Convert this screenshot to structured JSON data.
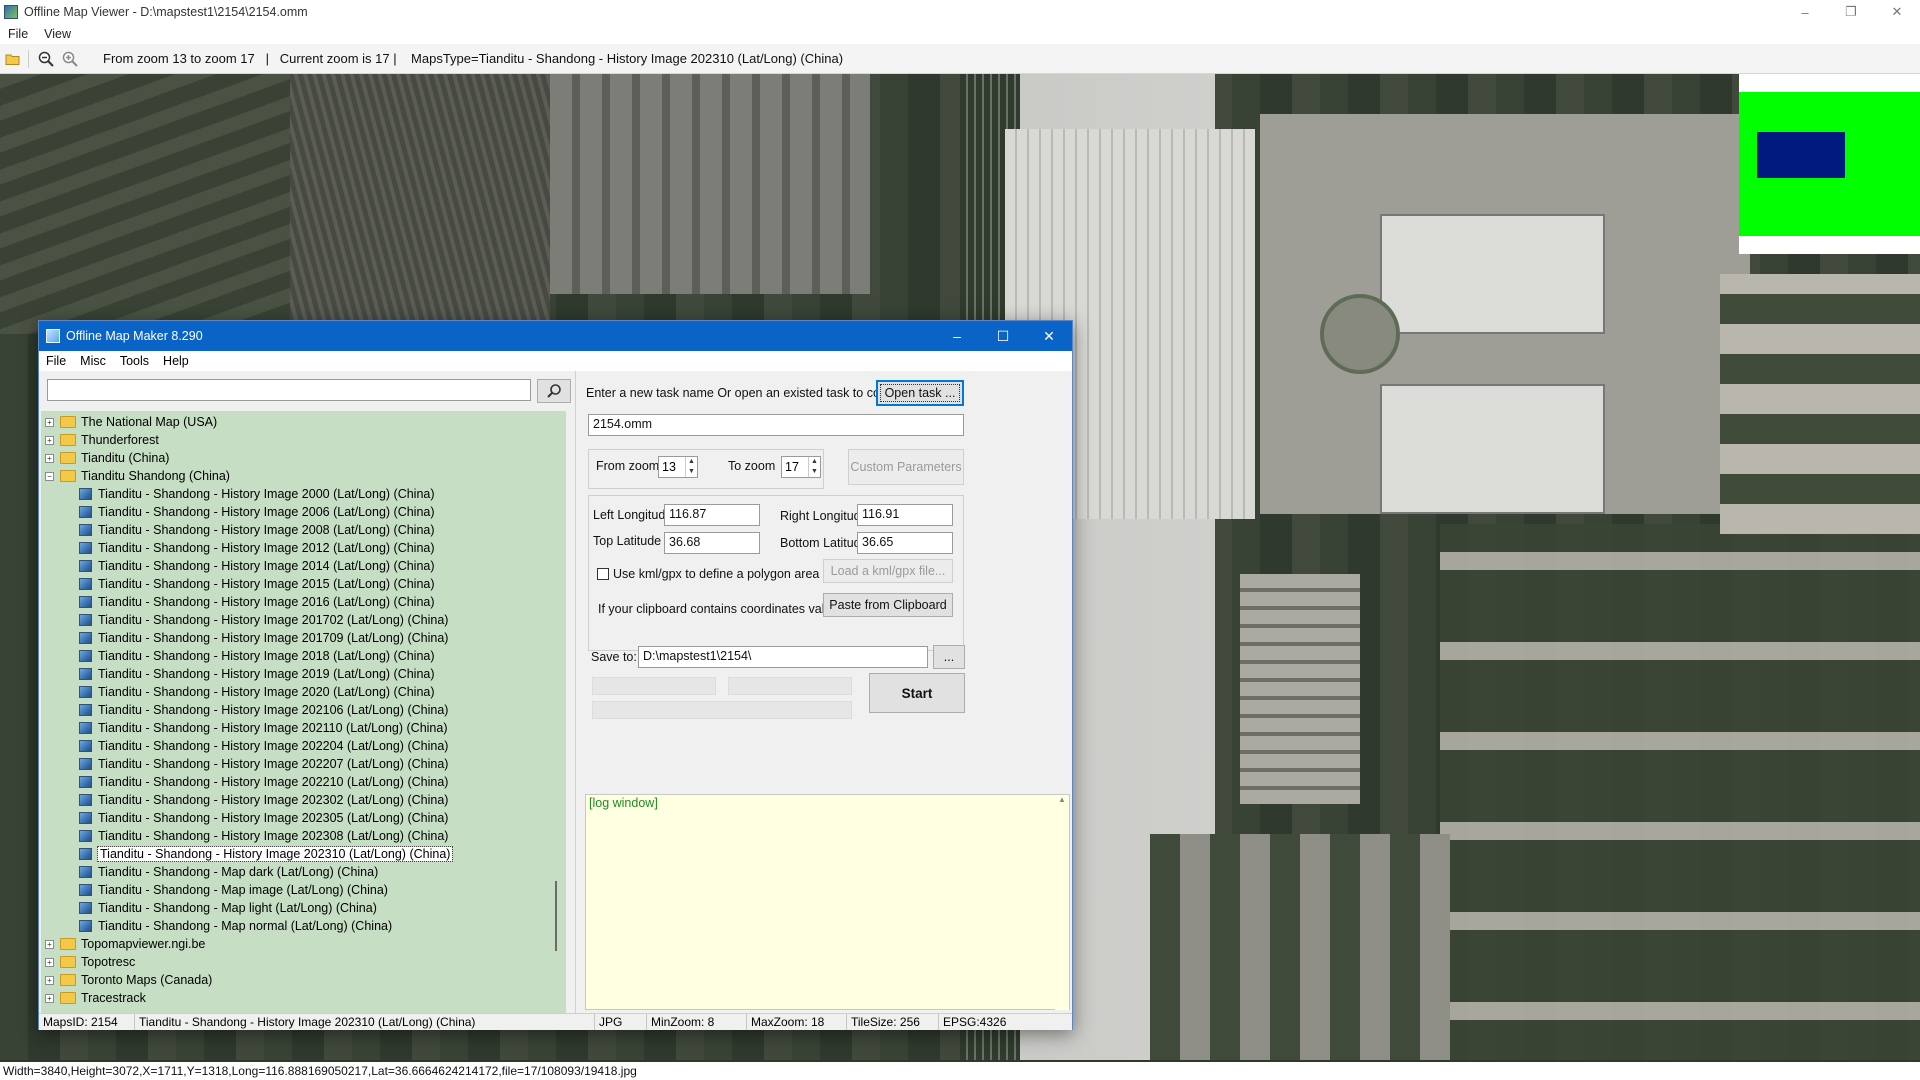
{
  "viewer": {
    "title": "Offline Map Viewer - D:\\mapstest1\\2154\\2154.omm",
    "menu": [
      "File",
      "View"
    ],
    "toolbar_info": "From zoom 13 to zoom 17   |   Current zoom is 17 |    MapsType=Tianditu - Shandong - History Image 202310 (Lat/Long) (China)",
    "status": "Width=3840,Height=3072,X=1711,Y=1318,Long=116.888169050217,Lat=36.6664624214172,file=17/108093/19418.jpg",
    "controls": [
      "–",
      "❐",
      "✕"
    ],
    "colors": {
      "minimap_bg": "#00ff00",
      "minimap_view": "#001a80"
    }
  },
  "dialog": {
    "title": "Offline Map Maker 8.290",
    "menu": [
      "File",
      "Misc",
      "Tools",
      "Help"
    ],
    "controls": [
      "–",
      "☐",
      "✕"
    ],
    "search": {
      "value": "",
      "icon": "search-icon"
    },
    "tree": [
      {
        "label": "The National Map (USA)",
        "type": "folder",
        "expander": "+"
      },
      {
        "label": "Thunderforest",
        "type": "folder",
        "expander": "+"
      },
      {
        "label": "Tianditu (China)",
        "type": "folder",
        "expander": "+"
      },
      {
        "label": "Tianditu Shandong (China)",
        "type": "folder",
        "expander": "−",
        "open": true
      },
      {
        "label": "Tianditu - Shandong - History Image 2000 (Lat/Long) (China)",
        "type": "map"
      },
      {
        "label": "Tianditu - Shandong - History Image 2006 (Lat/Long) (China)",
        "type": "map"
      },
      {
        "label": "Tianditu - Shandong - History Image 2008 (Lat/Long) (China)",
        "type": "map"
      },
      {
        "label": "Tianditu - Shandong - History Image 2012 (Lat/Long) (China)",
        "type": "map"
      },
      {
        "label": "Tianditu - Shandong - History Image 2014 (Lat/Long) (China)",
        "type": "map"
      },
      {
        "label": "Tianditu - Shandong - History Image 2015 (Lat/Long) (China)",
        "type": "map"
      },
      {
        "label": "Tianditu - Shandong - History Image 2016 (Lat/Long) (China)",
        "type": "map"
      },
      {
        "label": "Tianditu - Shandong - History Image 201702 (Lat/Long) (China)",
        "type": "map"
      },
      {
        "label": "Tianditu - Shandong - History Image 201709 (Lat/Long) (China)",
        "type": "map"
      },
      {
        "label": "Tianditu - Shandong - History Image 2018 (Lat/Long) (China)",
        "type": "map"
      },
      {
        "label": "Tianditu - Shandong - History Image 2019 (Lat/Long) (China)",
        "type": "map"
      },
      {
        "label": "Tianditu - Shandong - History Image 2020 (Lat/Long) (China)",
        "type": "map"
      },
      {
        "label": "Tianditu - Shandong - History Image 202106 (Lat/Long) (China)",
        "type": "map"
      },
      {
        "label": "Tianditu - Shandong - History Image 202110 (Lat/Long) (China)",
        "type": "map"
      },
      {
        "label": "Tianditu - Shandong - History Image 202204 (Lat/Long) (China)",
        "type": "map"
      },
      {
        "label": "Tianditu - Shandong - History Image 202207 (Lat/Long) (China)",
        "type": "map"
      },
      {
        "label": "Tianditu - Shandong - History Image 202210 (Lat/Long) (China)",
        "type": "map"
      },
      {
        "label": "Tianditu - Shandong - History Image 202302 (Lat/Long) (China)",
        "type": "map"
      },
      {
        "label": "Tianditu - Shandong - History Image 202305 (Lat/Long) (China)",
        "type": "map"
      },
      {
        "label": "Tianditu - Shandong - History Image 202308 (Lat/Long) (China)",
        "type": "map"
      },
      {
        "label": "Tianditu - Shandong - History Image 202310 (Lat/Long) (China)",
        "type": "map",
        "selected": true
      },
      {
        "label": "Tianditu - Shandong - Map dark (Lat/Long) (China)",
        "type": "map"
      },
      {
        "label": "Tianditu - Shandong - Map image (Lat/Long) (China)",
        "type": "map"
      },
      {
        "label": "Tianditu - Shandong - Map light (Lat/Long) (China)",
        "type": "map"
      },
      {
        "label": "Tianditu - Shandong - Map normal (Lat/Long) (China)",
        "type": "map"
      },
      {
        "label": "Topomapviewer.ngi.be",
        "type": "folder",
        "expander": "+"
      },
      {
        "label": "Topotresc",
        "type": "folder",
        "expander": "+"
      },
      {
        "label": "Toronto Maps (Canada)",
        "type": "folder",
        "expander": "+"
      },
      {
        "label": "Tracestrack",
        "type": "folder",
        "expander": "+"
      }
    ],
    "task_prompt": "Enter a new task name Or open an existed task to continue:",
    "open_task_label": "Open task ...",
    "task_name": "2154.omm",
    "from_zoom_label": "From zoom",
    "from_zoom": "13",
    "to_zoom_label": "To zoom",
    "to_zoom": "17",
    "custom_params_label": "Custom Parameters",
    "left_lon_label": "Left Longitude",
    "left_lon": "116.87",
    "right_lon_label": "Right Longitude",
    "right_lon": "116.91",
    "top_lat_label": "Top Latitude",
    "top_lat": "36.68",
    "bottom_lat_label": "Bottom Latitude",
    "bottom_lat": "36.65",
    "kml_label": "Use kml/gpx to define a polygon area",
    "load_kml_label": "Load a kml/gpx file...",
    "clipboard_prompt": "If your clipboard contains coordinates values:",
    "paste_label": "Paste from Clipboard",
    "save_to_label": "Save to:",
    "save_to": "D:\\mapstest1\\2154\\",
    "browse_label": "...",
    "start_label": "Start",
    "log_text": "[log window]",
    "status": {
      "maps_id": "MapsID: 2154",
      "map_name": "Tianditu - Shandong - History Image 202310 (Lat/Long) (China)",
      "format": "JPG",
      "min_zoom": "MinZoom: 8",
      "max_zoom": "MaxZoom: 18",
      "tile_size": "TileSize: 256",
      "epsg": "EPSG:4326"
    }
  }
}
